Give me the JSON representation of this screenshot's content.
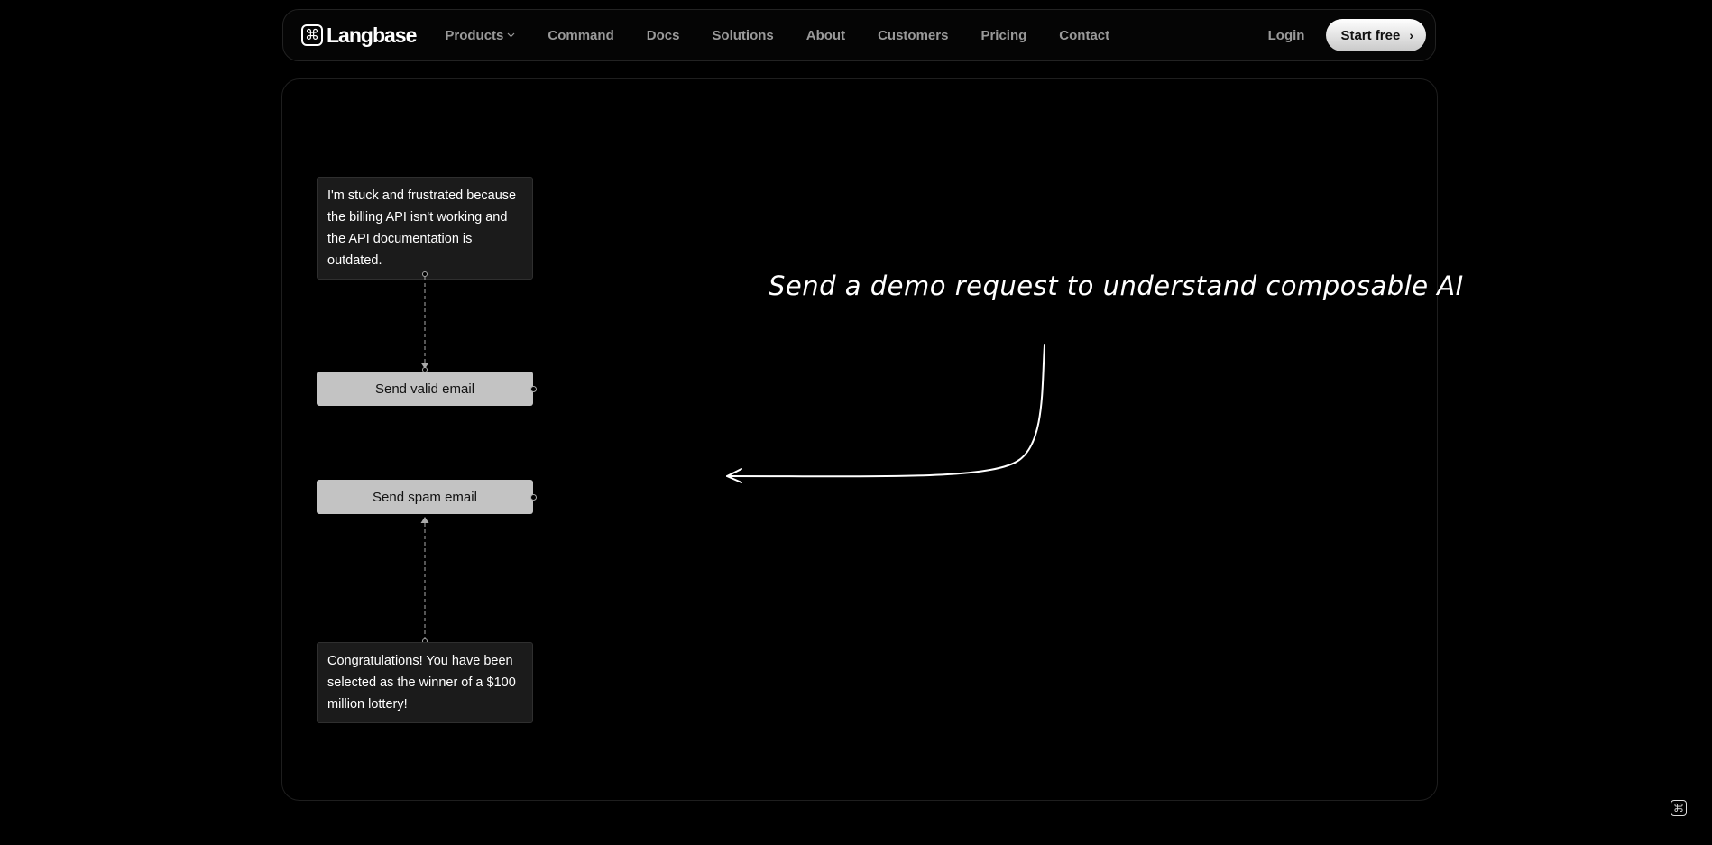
{
  "nav": {
    "brand": "Langbase",
    "logo_glyph": "⌘",
    "links": [
      {
        "label": "Products"
      },
      {
        "label": "Command"
      },
      {
        "label": "Docs"
      },
      {
        "label": "Solutions"
      },
      {
        "label": "About"
      },
      {
        "label": "Customers"
      },
      {
        "label": "Pricing"
      },
      {
        "label": "Contact"
      }
    ],
    "login": "Login",
    "cta": "Start free",
    "cta_arrow": "›"
  },
  "flow": {
    "input_message": "I'm stuck and frustrated because the billing API isn't working and the API documentation is outdated.",
    "valid_action": "Send valid email",
    "spam_action": "Send spam email",
    "spam_message": "Congratulations! You have been selected as the winner of a $100 million lottery!"
  },
  "annotation": "Send a demo request to understand composable AI",
  "corner_glyph": "⌘"
}
